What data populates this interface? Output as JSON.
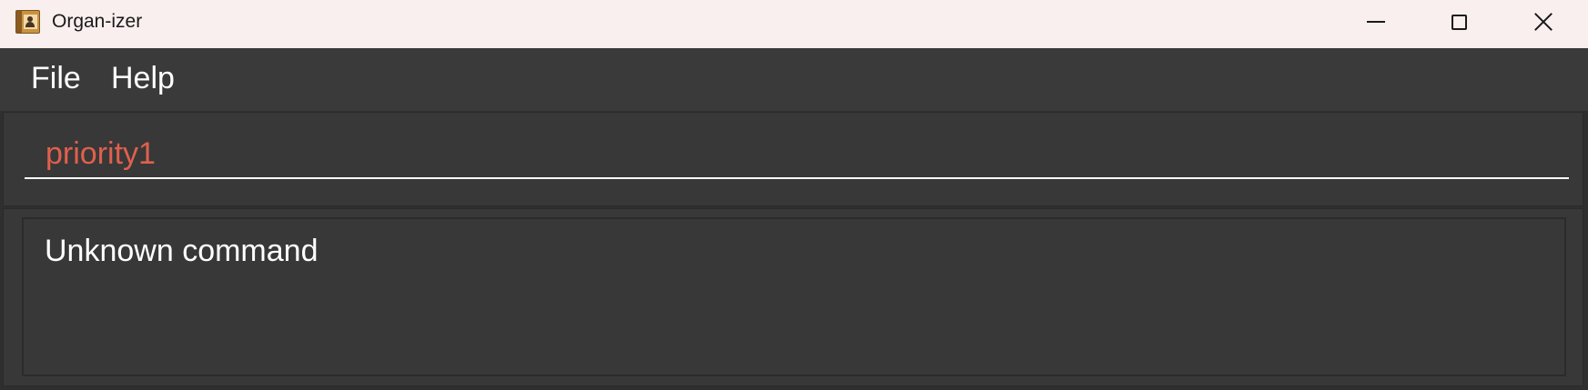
{
  "window": {
    "title": "Organ-izer",
    "app_icon": "address-book-icon",
    "controls": {
      "minimize_icon": "minimize-icon",
      "maximize_icon": "maximize-icon",
      "close_icon": "close-icon"
    },
    "titlebar_color": "#f8efee"
  },
  "menu": {
    "items": [
      {
        "label": "File"
      },
      {
        "label": "Help"
      }
    ]
  },
  "command_box": {
    "value": "priority1",
    "text_color": "#e0604d",
    "state": "error"
  },
  "result_display": {
    "text": "Unknown command"
  },
  "colors": {
    "background": "#383838",
    "menubar": "#3a3a3a",
    "text": "#ffffff"
  }
}
